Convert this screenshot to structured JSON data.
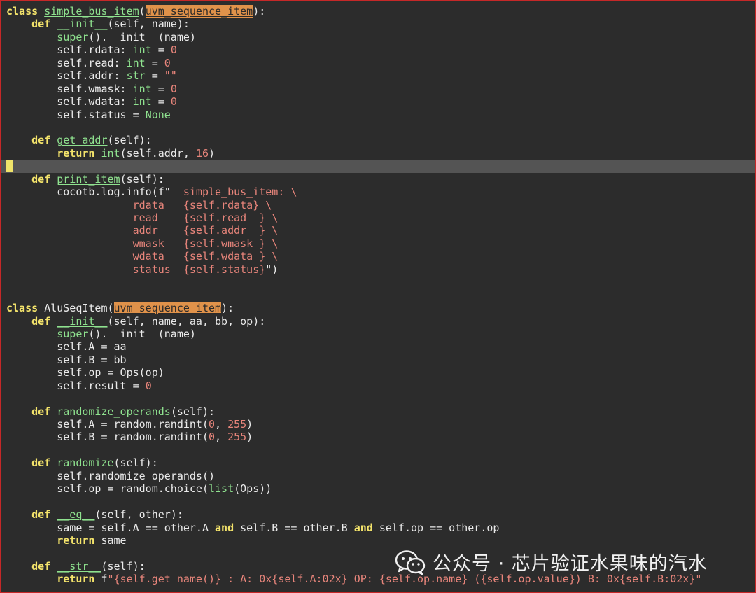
{
  "code_lines": [
    [
      [
        "kw",
        "class"
      ],
      [
        "p",
        " "
      ],
      [
        "fn",
        "simple_bus_item"
      ],
      [
        "p",
        "("
      ],
      [
        "hl",
        "uvm_sequence_item"
      ],
      [
        "p",
        "):"
      ]
    ],
    [
      [
        "p",
        "    "
      ],
      [
        "kw",
        "def"
      ],
      [
        "p",
        " "
      ],
      [
        "fn",
        "__init__"
      ],
      [
        "p",
        "(self, name):"
      ]
    ],
    [
      [
        "p",
        "        "
      ],
      [
        "bi",
        "super"
      ],
      [
        "p",
        "()."
      ],
      [
        "p",
        "__init__(name)"
      ]
    ],
    [
      [
        "p",
        "        self.rdata: "
      ],
      [
        "bi",
        "int"
      ],
      [
        "p",
        " = "
      ],
      [
        "num",
        "0"
      ]
    ],
    [
      [
        "p",
        "        self.read: "
      ],
      [
        "bi",
        "int"
      ],
      [
        "p",
        " = "
      ],
      [
        "num",
        "0"
      ]
    ],
    [
      [
        "p",
        "        self.addr: "
      ],
      [
        "bi",
        "str"
      ],
      [
        "p",
        " = "
      ],
      [
        "str",
        "\"\""
      ]
    ],
    [
      [
        "p",
        "        self.wmask: "
      ],
      [
        "bi",
        "int"
      ],
      [
        "p",
        " = "
      ],
      [
        "num",
        "0"
      ]
    ],
    [
      [
        "p",
        "        self.wdata: "
      ],
      [
        "bi",
        "int"
      ],
      [
        "p",
        " = "
      ],
      [
        "num",
        "0"
      ]
    ],
    [
      [
        "p",
        "        self.status = "
      ],
      [
        "bi",
        "None"
      ]
    ],
    [],
    [
      [
        "p",
        "    "
      ],
      [
        "kw",
        "def"
      ],
      [
        "p",
        " "
      ],
      [
        "fn",
        "get_addr"
      ],
      [
        "p",
        "(self):"
      ]
    ],
    [
      [
        "p",
        "        "
      ],
      [
        "kw",
        "return"
      ],
      [
        "p",
        " "
      ],
      [
        "bi",
        "int"
      ],
      [
        "p",
        "(self.addr, "
      ],
      [
        "num",
        "16"
      ],
      [
        "p",
        ")"
      ]
    ],
    [],
    [
      [
        "p",
        "    "
      ],
      [
        "kw",
        "def"
      ],
      [
        "p",
        " "
      ],
      [
        "fn",
        "print_item"
      ],
      [
        "p",
        "(self):"
      ]
    ],
    [
      [
        "p",
        "        cocotb.log.info(f\"  "
      ],
      [
        "str",
        "simple_bus_item: \\"
      ]
    ],
    [
      [
        "p",
        "                    "
      ],
      [
        "str",
        "rdata   {self.rdata} \\"
      ]
    ],
    [
      [
        "p",
        "                    "
      ],
      [
        "str",
        "read    {self.read  } \\"
      ]
    ],
    [
      [
        "p",
        "                    "
      ],
      [
        "str",
        "addr    {self.addr  } \\"
      ]
    ],
    [
      [
        "p",
        "                    "
      ],
      [
        "str",
        "wmask   {self.wmask } \\"
      ]
    ],
    [
      [
        "p",
        "                    "
      ],
      [
        "str",
        "wdata   {self.wdata } \\"
      ]
    ],
    [
      [
        "p",
        "                    "
      ],
      [
        "str",
        "status  {self.status}"
      ],
      [
        "p",
        "\")"
      ]
    ],
    [],
    [],
    [
      [
        "kw",
        "class"
      ],
      [
        "p",
        " "
      ],
      [
        "p",
        "AluSeqItem("
      ],
      [
        "hl",
        "uvm_sequence_item"
      ],
      [
        "p",
        "):"
      ]
    ],
    [
      [
        "p",
        "    "
      ],
      [
        "kw",
        "def"
      ],
      [
        "p",
        " "
      ],
      [
        "fn",
        "__init__"
      ],
      [
        "p",
        "(self, name, aa, bb, op):"
      ]
    ],
    [
      [
        "p",
        "        "
      ],
      [
        "bi",
        "super"
      ],
      [
        "p",
        "()."
      ],
      [
        "p",
        "__init__(name)"
      ]
    ],
    [
      [
        "p",
        "        self.A = aa"
      ]
    ],
    [
      [
        "p",
        "        self.B = bb"
      ]
    ],
    [
      [
        "p",
        "        self.op = Ops(op)"
      ]
    ],
    [
      [
        "p",
        "        self.result = "
      ],
      [
        "num",
        "0"
      ]
    ],
    [],
    [
      [
        "p",
        "    "
      ],
      [
        "kw",
        "def"
      ],
      [
        "p",
        " "
      ],
      [
        "fn",
        "randomize_operands"
      ],
      [
        "p",
        "(self):"
      ]
    ],
    [
      [
        "p",
        "        self.A = random.randint("
      ],
      [
        "num",
        "0"
      ],
      [
        "p",
        ", "
      ],
      [
        "num",
        "255"
      ],
      [
        "p",
        ")"
      ]
    ],
    [
      [
        "p",
        "        self.B = random.randint("
      ],
      [
        "num",
        "0"
      ],
      [
        "p",
        ", "
      ],
      [
        "num",
        "255"
      ],
      [
        "p",
        ")"
      ]
    ],
    [],
    [
      [
        "p",
        "    "
      ],
      [
        "kw",
        "def"
      ],
      [
        "p",
        " "
      ],
      [
        "fn",
        "randomize"
      ],
      [
        "p",
        "(self):"
      ]
    ],
    [
      [
        "p",
        "        self.randomize_operands()"
      ]
    ],
    [
      [
        "p",
        "        self.op = random.choice("
      ],
      [
        "bi",
        "list"
      ],
      [
        "p",
        "(Ops))"
      ]
    ],
    [],
    [
      [
        "p",
        "    "
      ],
      [
        "kw",
        "def"
      ],
      [
        "p",
        " "
      ],
      [
        "fn",
        "__eq__"
      ],
      [
        "p",
        "(self, other):"
      ]
    ],
    [
      [
        "p",
        "        same = self.A == other.A "
      ],
      [
        "kw",
        "and"
      ],
      [
        "p",
        " self.B == other.B "
      ],
      [
        "kw",
        "and"
      ],
      [
        "p",
        " self.op == other.op"
      ]
    ],
    [
      [
        "p",
        "        "
      ],
      [
        "kw",
        "return"
      ],
      [
        "p",
        " same"
      ]
    ],
    [],
    [
      [
        "p",
        "    "
      ],
      [
        "kw",
        "def"
      ],
      [
        "p",
        " "
      ],
      [
        "fn",
        "__str__"
      ],
      [
        "p",
        "(self):"
      ]
    ],
    [
      [
        "p",
        "        "
      ],
      [
        "kw",
        "return"
      ],
      [
        "p",
        " f"
      ],
      [
        "str",
        "\"{self.get_name()} : A: 0x{self.A:02x} OP: {self.op.name} ({self.op.value}) B: 0x{self.B:02x}\""
      ]
    ]
  ],
  "current_line_index": 12,
  "watermark": {
    "icon": "wechat-icon",
    "text": "公众号 · 芯片验证水果味的汽水"
  },
  "colors": {
    "background": "#2c2c2c",
    "keyword": "#f3e36b",
    "function": "#8fe28f",
    "number": "#e8857b",
    "highlight": "#e0924a",
    "current_line": "#545454",
    "border": "#c62828"
  }
}
